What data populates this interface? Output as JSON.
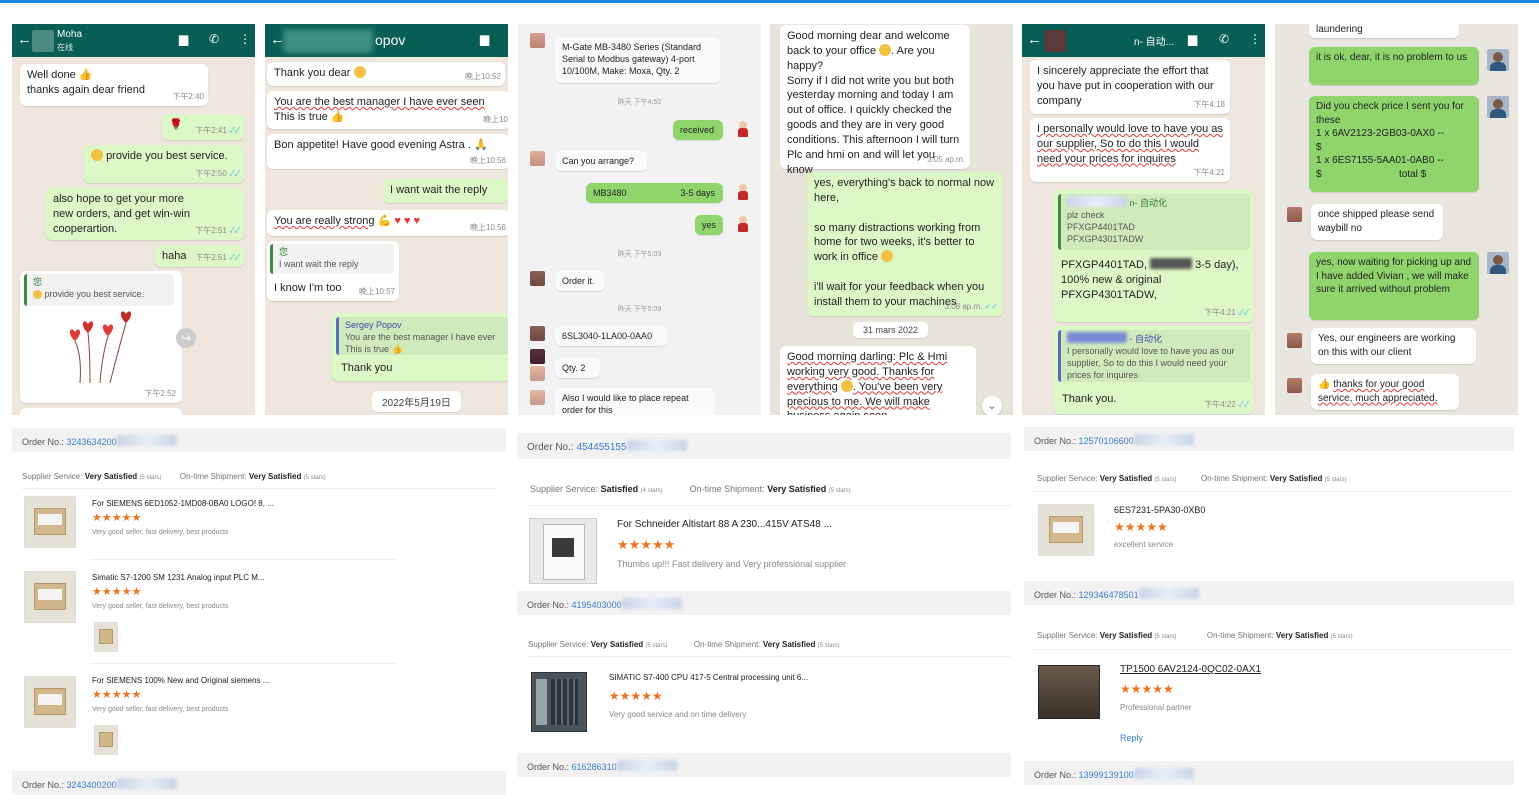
{
  "colors": {
    "whatsapp_header": "#075e54",
    "outgoing_bubble": "#dcf8c6",
    "green_bubble": "#8fd56b",
    "star": "#f2711c",
    "link": "#3a7bd5"
  },
  "chat1": {
    "contact": "Moha",
    "status": "在线",
    "msg1_line1": "Well done",
    "msg1_line2": "thanks again dear friend",
    "msg1_time": "下午2:40",
    "msg2_time": "下午2:41",
    "msg3": "provide you best service.",
    "msg3_time": "下午2:50",
    "msg4": "also hope to get your more new orders, and get win-win cooperartion.",
    "msg4_time": "下午2:51",
    "msg5": "haha",
    "msg5_time": "下午2:51",
    "quote_name": "您",
    "quote_text": "provide you best service.",
    "image_time": "下午2:52"
  },
  "chat2": {
    "contact": "opov",
    "msg1": "Thank you  dear",
    "msg1_time": "晚上10:52",
    "msg2": "You are the best manager I have ever seen",
    "msg2b": "This is true",
    "msg2_time": "晚上10",
    "msg3": "Bon appetite! Have good evening Astra .",
    "msg3_time": "晚上10:56",
    "msg4": "I want wait the reply",
    "msg5": "You are really strong",
    "msg5_time": "晚上10:56",
    "quote_name": "您",
    "quote_text": "I want wait the reply",
    "msg6": "I know I'm too",
    "msg6_time": "晚上10:57",
    "quote2_name": "Sergey Popov",
    "quote2_text1": "You are the best manager I have ever",
    "quote2_text2": "This is true",
    "msg7": "Thank you",
    "date_chip": "2022年5月19日"
  },
  "chat3": {
    "msg1": "M-Gate MB-3480 Series (Standard Serial to Modbus gateway) 4-port 10/100M, Make: Moxa, Qty. 2",
    "time1": "昨天 下午4:52",
    "msg2": "received",
    "msg3": "Can you arrange?",
    "msg4_left": "MB3480",
    "msg4_right": "3-5 days",
    "msg5": "yes",
    "time2": "昨天 下午5:03",
    "msg6": "Order it.",
    "time3": "昨天 下午5:09",
    "msg7": "6SL3040-1LA00-0AA0",
    "msg8": "Qty. 2",
    "msg9": "Also I would like to place repeat order for this"
  },
  "chat4": {
    "msg1": "Good morning dear and welcome back to your office",
    "msg1b": ". Are you happy?",
    "msg1c": "Sorry if I did not write you but both yesterday morning and today I am out of office. I quickly checked the goods and they are in very good conditions. This afternoon I will turn Plc and hmi on and will let you know",
    "msg1_time": "3:05 ap.m.",
    "msg2a": "yes, everything's back to normal now here,",
    "msg2b": "so many distractions working from home for two weeks, it's better to work in office",
    "msg2c": "i'll wait for your feedback when you install them to your machines",
    "msg2_time": "3:08 ap.m.",
    "date_chip": "31 mars 2022",
    "msg3": "Good morning darling: Plc & Hmi working very good. Thanks for everything",
    "msg3b": ". You've been very precious to me. We will make business again soon"
  },
  "chat5": {
    "contact": "n- 自动...",
    "msg1": "I sincerely appreciate the effort that you have put in cooperation with our company",
    "msg1_time": "下午4:18",
    "msg2": "I personally would love to have you as our supplier, So to do this I would need your prices for inquires",
    "msg2_time": "下午4:21",
    "quote_name": "n- 自动化",
    "quote_text1": "plz check",
    "quote_text2": "PFXGP4401TAD",
    "quote_text3": "PFXGP4301TADW",
    "msg3a": "PFXGP4401TAD,",
    "msg3b": "3-5 day),",
    "msg3c": "100% new & original",
    "msg3d": "PFXGP4301TADW,",
    "msg3_time": "下午4:21",
    "quote2_name": "- 自动化",
    "quote2_text": "I personally would love to have you as our supplier, So to do this I would need your prices for inquires",
    "msg4": "Thank you.",
    "msg4_time": "下午4:22"
  },
  "chat6": {
    "msg0": "laundering",
    "msg1": "it is ok, dear, it is no problem to us",
    "msg2": "Did you check price I sent you for these",
    "msg2b": "1 x 6AV2123-2GB03-0AX0  --",
    "msg2c": "$",
    "msg2d": "1 x 6ES7155-5AA01-0AB0  --",
    "msg2e": "$",
    "msg2f": "total $",
    "msg3": "once shipped please send waybill no",
    "msg4": "yes, now waiting for picking up and I have added Vivian , we will make sure it arrived without problem",
    "msg5": "Yes, our engineers are working on this with our client",
    "msg6": "thanks for your good service, much appreciated."
  },
  "orders1": {
    "order_label": "Order No.:",
    "order_no": "3243634200",
    "supplier_label": "Supplier Service:",
    "supplier_value": "Very Satisfied",
    "supplier_stars": "(5 stars)",
    "shipment_label": "On-time Shipment:",
    "shipment_value": "Very Satisfied",
    "shipment_stars": "(5 stars)",
    "items": [
      {
        "title": "For SIEMENS 6ED1052-1MD08-0BA0 LOGO! 8, ...",
        "stars": "★★★★★",
        "text": "Very good seller, fast delivery, best products"
      },
      {
        "title": "Simatic S7-1200 SM 1231 Analog input PLC M...",
        "stars": "★★★★★",
        "text": "Very good seller, fast delivery, best products"
      },
      {
        "title": "For SIEMENS 100% New and Original siemens ...",
        "stars": "★★★★★",
        "text": "Very good seller, fast delivery, best products"
      }
    ],
    "order2_label": "Order No.:",
    "order2_no": "3243400200"
  },
  "orders2": {
    "order_label": "Order No.:",
    "order_no": "454455155",
    "supplier_label": "Supplier Service:",
    "supplier_value": "Satisfied",
    "supplier_stars": "(4 stars)",
    "shipment_label": "On-time Shipment:",
    "shipment_value": "Very Satisfied",
    "shipment_stars": "(5 stars)",
    "item1_title": "For Schneider Altistart 88 A 230...415V ATS48 ...",
    "item1_stars": "★★★★★",
    "item1_text": "Thumbs up!!! Fast delivery and Very professional supplier",
    "order2_label": "Order No.:",
    "order2_no": "4195403000",
    "supplier2_label": "Supplier Service:",
    "supplier2_value": "Very Satisfied",
    "supplier2_stars": "(5 stars)",
    "shipment2_label": "On-time Shipment:",
    "shipment2_value": "Very Satisfied",
    "shipment2_stars": "(5 stars)",
    "item2_title": "SIMATIC S7-400 CPU 417-5 Central processing unit 6...",
    "item2_stars": "★★★★★",
    "item2_text": "Very good service and on time delivery",
    "order3_label": "Order No.:",
    "order3_no": "616286310"
  },
  "orders3": {
    "order_label": "Order No.:",
    "order_no": "12570106600",
    "supplier_label": "Supplier Service:",
    "supplier_value": "Very Satisfied",
    "supplier_stars": "(5 stars)",
    "shipment_label": "On-time Shipment:",
    "shipment_value": "Very Satisfied",
    "shipment_stars": "(5 stars)",
    "item1_title": "6ES7231-5PA30-0XB0",
    "item1_stars": "★★★★★",
    "item1_text": "excellent service",
    "order2_label": "Order No.:",
    "order2_no": "129346478501",
    "supplier2_label": "Supplier Service:",
    "supplier2_value": "Very Satisfied",
    "supplier2_stars": "(5 stars)",
    "shipment2_label": "On-time Shipment:",
    "shipment2_value": "Very Satisfied",
    "shipment2_stars": "(5 stars)",
    "item2_title": "TP1500 6AV2124-0QC02-0AX1",
    "item2_stars": "★★★★★",
    "item2_text": "Professional partner",
    "reply": "Reply",
    "order3_label": "Order No.:",
    "order3_no": "13999139100"
  }
}
